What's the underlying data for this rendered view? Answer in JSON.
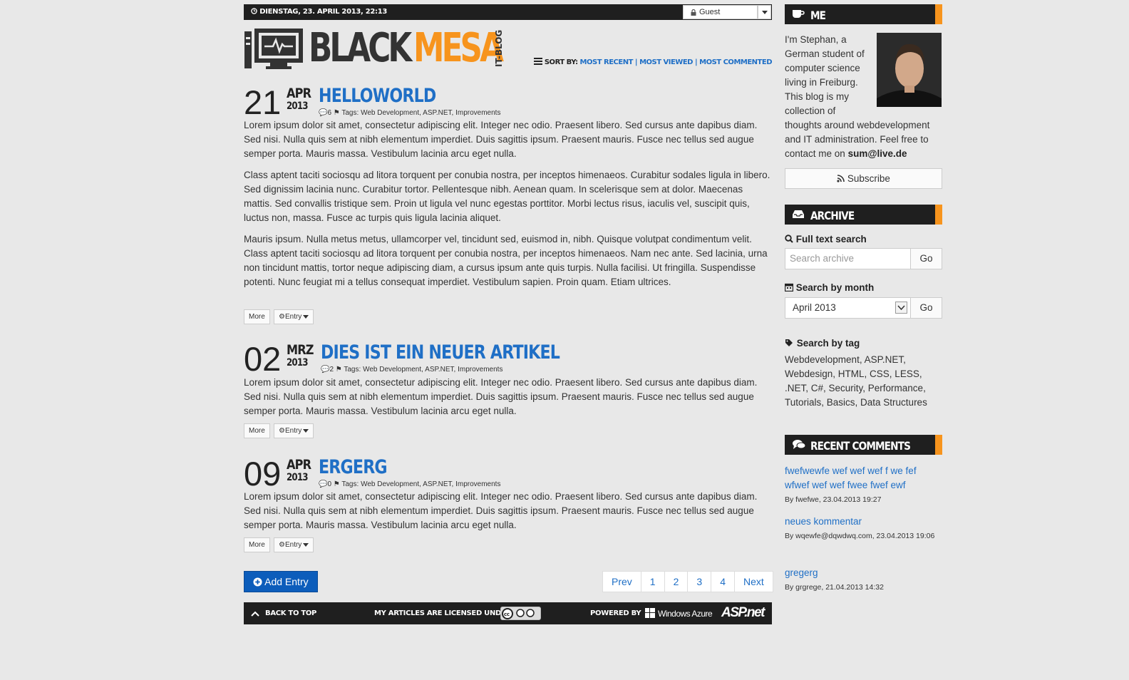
{
  "topbar": {
    "date": "DIENSTAG, 23. APRIL 2013, 22:13",
    "user": "Guest"
  },
  "logo": {
    "black": "BLACK",
    "mesa": "MESA",
    "tag": "IT-BLOG"
  },
  "sort": {
    "label": "SORT BY:",
    "options": [
      "MOST RECENT",
      "MOST VIEWED",
      "MOST COMMENTED"
    ]
  },
  "posts": [
    {
      "day": "21",
      "month": "APR",
      "year": "2013",
      "title": "HELLOWORLD",
      "comments": "6",
      "tags_label": "Tags:",
      "tags": "Web Development, ASP.NET, Improvements",
      "paragraphs": [
        "Lorem ipsum dolor sit amet, consectetur adipiscing elit. Integer nec odio. Praesent libero. Sed cursus ante dapibus diam. Sed nisi. Nulla quis sem at nibh elementum imperdiet. Duis sagittis ipsum. Praesent mauris. Fusce nec tellus sed augue semper porta. Mauris massa. Vestibulum lacinia arcu eget nulla.",
        "Class aptent taciti sociosqu ad litora torquent per conubia nostra, per inceptos himenaeos. Curabitur sodales ligula in libero. Sed dignissim lacinia nunc. Curabitur tortor. Pellentesque nibh. Aenean quam. In scelerisque sem at dolor. Maecenas mattis. Sed convallis tristique sem. Proin ut ligula vel nunc egestas porttitor. Morbi lectus risus, iaculis vel, suscipit quis, luctus non, massa. Fusce ac turpis quis ligula lacinia aliquet.",
        "Mauris ipsum. Nulla metus metus, ullamcorper vel, tincidunt sed, euismod in, nibh. Quisque volutpat condimentum velit. Class aptent taciti sociosqu ad litora torquent per conubia nostra, per inceptos himenaeos. Nam nec ante. Sed lacinia, urna non tincidunt mattis, tortor neque adipiscing diam, a cursus ipsum ante quis turpis. Nulla facilisi. Ut fringilla. Suspendisse potenti. Nunc feugiat mi a tellus consequat imperdiet. Vestibulum sapien. Proin quam. Etiam ultrices."
      ]
    },
    {
      "day": "02",
      "month": "MRZ",
      "year": "2013",
      "title": "DIES IST EIN NEUER ARTIKEL",
      "comments": "2",
      "tags_label": "Tags:",
      "tags": "Web Development, ASP.NET, Improvements",
      "paragraphs": [
        "Lorem ipsum dolor sit amet, consectetur adipiscing elit. Integer nec odio. Praesent libero. Sed cursus ante dapibus diam. Sed nisi. Nulla quis sem at nibh elementum imperdiet. Duis sagittis ipsum. Praesent mauris. Fusce nec tellus sed augue semper porta. Mauris massa. Vestibulum lacinia arcu eget nulla."
      ]
    },
    {
      "day": "09",
      "month": "APR",
      "year": "2013",
      "title": "ERGERG",
      "comments": "0",
      "tags_label": "Tags:",
      "tags": "Web Development, ASP.NET, Improvements",
      "paragraphs": [
        "Lorem ipsum dolor sit amet, consectetur adipiscing elit. Integer nec odio. Praesent libero. Sed cursus ante dapibus diam. Sed nisi. Nulla quis sem at nibh elementum imperdiet. Duis sagittis ipsum. Praesent mauris. Fusce nec tellus sed augue semper porta. Mauris massa. Vestibulum lacinia arcu eget nulla."
      ]
    }
  ],
  "post_buttons": {
    "more": "More",
    "entry": "Entry"
  },
  "add_entry": "Add Entry",
  "pager": {
    "prev": "Prev",
    "pages": [
      "1",
      "2",
      "3",
      "4"
    ],
    "next": "Next"
  },
  "footer": {
    "back_to_top": "BACK TO TOP",
    "licensed": "MY ARTICLES ARE LICENSED UNDER",
    "powered": "POWERED BY",
    "azure": "Windows Azure",
    "aspnet": "ASP.net"
  },
  "sidebar": {
    "me": {
      "heading": "ME",
      "text": "I'm Stephan, a German student of computer science living in Freiburg. This blog is my collection of thoughts around webdevelopment and IT administration. Feel free to contact me on",
      "email": "sum@live.de",
      "subscribe": "Subscribe"
    },
    "archive": {
      "heading": "ARCHIVE",
      "fulltext_label": "Full text search",
      "search_placeholder": "Search archive",
      "go": "Go",
      "month_label": "Search by month",
      "month_value": "April 2013",
      "tag_label": "Search by tag",
      "tags": "Webdevelopment, ASP.NET, Webdesign, HTML, CSS, LESS, .NET, C#, Security, Performance, Tutorials, Basics, Data Structures"
    },
    "recent": {
      "heading": "RECENT COMMENTS",
      "items": [
        {
          "text": "fwefwewfe wef wef wef f we fef wfwef wef wef fwee fwef ewf",
          "by": "By fwefwe, 23.04.2013 19:27"
        },
        {
          "text": "neues kommentar",
          "by": "By wqewfe@dqwdwq.com, 23.04.2013 19:06"
        },
        {
          "text": "gregerg",
          "by": "By grgrege, 21.04.2013 14:32"
        }
      ]
    }
  },
  "colors": {
    "accent": "#f7941d",
    "link": "#1f6fc6",
    "dark": "#1f1f1f",
    "primary_button": "#0c5dbb"
  }
}
